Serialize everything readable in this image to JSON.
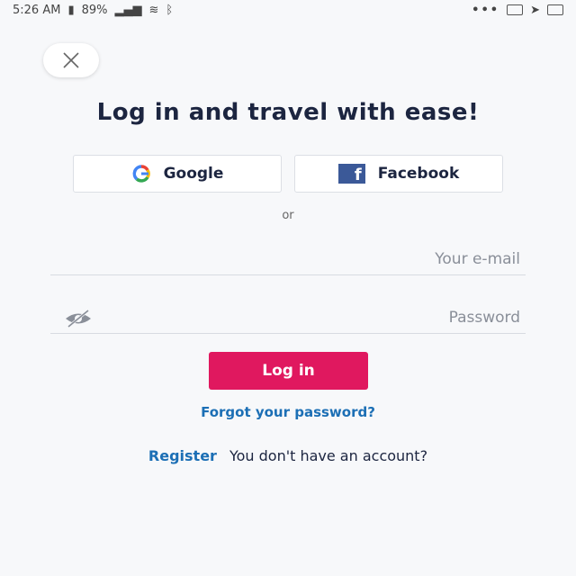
{
  "status_bar": {
    "time": "5:26 AM",
    "battery": "89%",
    "more_dots": "•••"
  },
  "title": "Log in and travel with ease!",
  "social": {
    "google_label": "Google",
    "facebook_label": "Facebook"
  },
  "or_text": "or",
  "fields": {
    "email_placeholder": "Your e-mail",
    "password_placeholder": "Password"
  },
  "login_label": "Log in",
  "forgot_label": "Forgot your password?",
  "register": {
    "prompt": "You don't have an account?",
    "link": "Register"
  },
  "colors": {
    "accent": "#e0185f",
    "link": "#1c6fb5",
    "facebook": "#3b5998"
  }
}
